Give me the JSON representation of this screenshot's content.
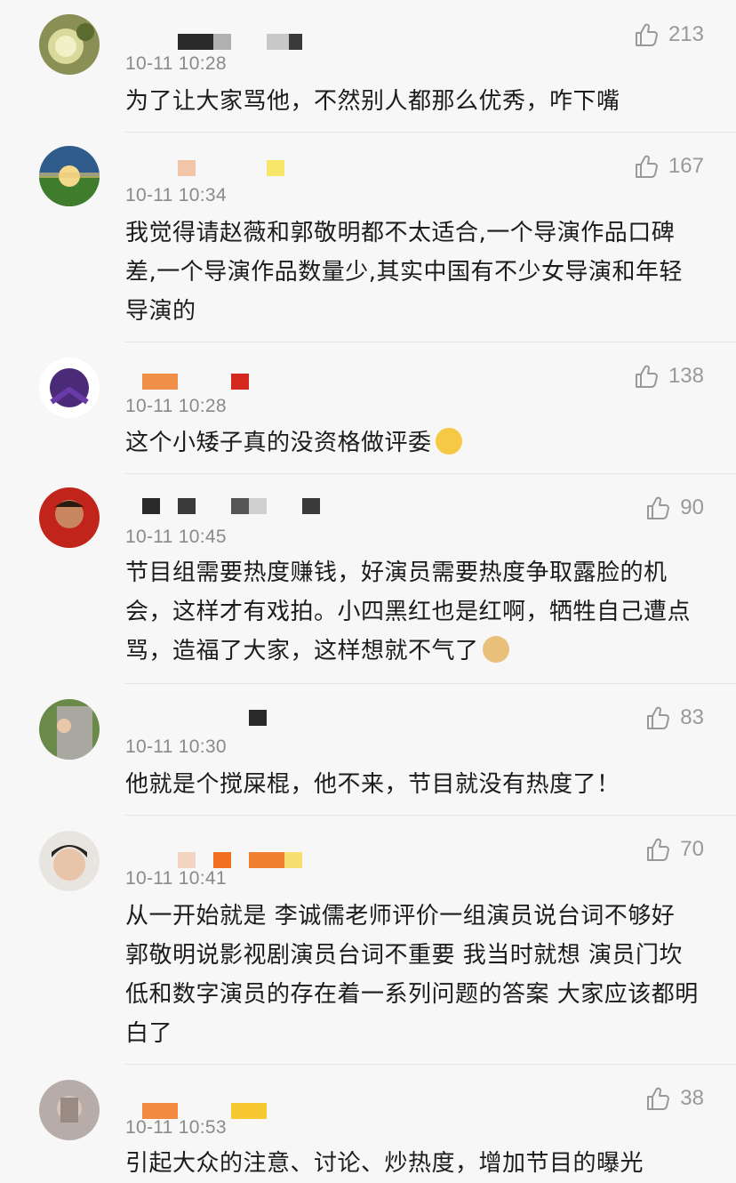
{
  "comments": [
    {
      "time": "10-11 10:28",
      "text": "为了让大家骂他，不然别人都那么优秀，咋下嘴",
      "likes": "213"
    },
    {
      "time": "10-11 10:34",
      "text": "我觉得请赵薇和郭敬明都不太适合,一个导演作品口碑差,一个导演作品数量少,其实中国有不少女导演和年轻导演的",
      "likes": "167"
    },
    {
      "time": "10-11 10:28",
      "text": "这个小矮子真的没资格做评委",
      "likes": "138",
      "emoji": "drooling-face"
    },
    {
      "time": "10-11 10:45",
      "text": "节目组需要热度赚钱，好演员需要热度争取露脸的机会，这样才有戏拍。小四黑红也是红啊，牺牲自己遭点骂，造福了大家，这样想就不气了",
      "likes": "90",
      "emoji": "doge-face"
    },
    {
      "time": "10-11 10:30",
      "text": "他就是个搅屎棍，他不来，节目就没有热度了！",
      "likes": "83"
    },
    {
      "time": "10-11 10:41",
      "text": "从一开始就是 李诚儒老师评价一组演员说台词不够好 郭敬明说影视剧演员台词不重要 我当时就想 演员门坎低和数字演员的存在着一系列问题的答案 大家应该都明白了",
      "likes": "70"
    },
    {
      "time": "10-11 10:53",
      "text": "引起大众的注意、讨论、炒热度，增加节目的曝光",
      "likes": "38"
    }
  ],
  "icons": {
    "like": "thumbs-up-icon"
  },
  "colors": {
    "like_gray": "#999999",
    "time_gray": "#8a8a8a",
    "divider": "#e2e2e2"
  }
}
